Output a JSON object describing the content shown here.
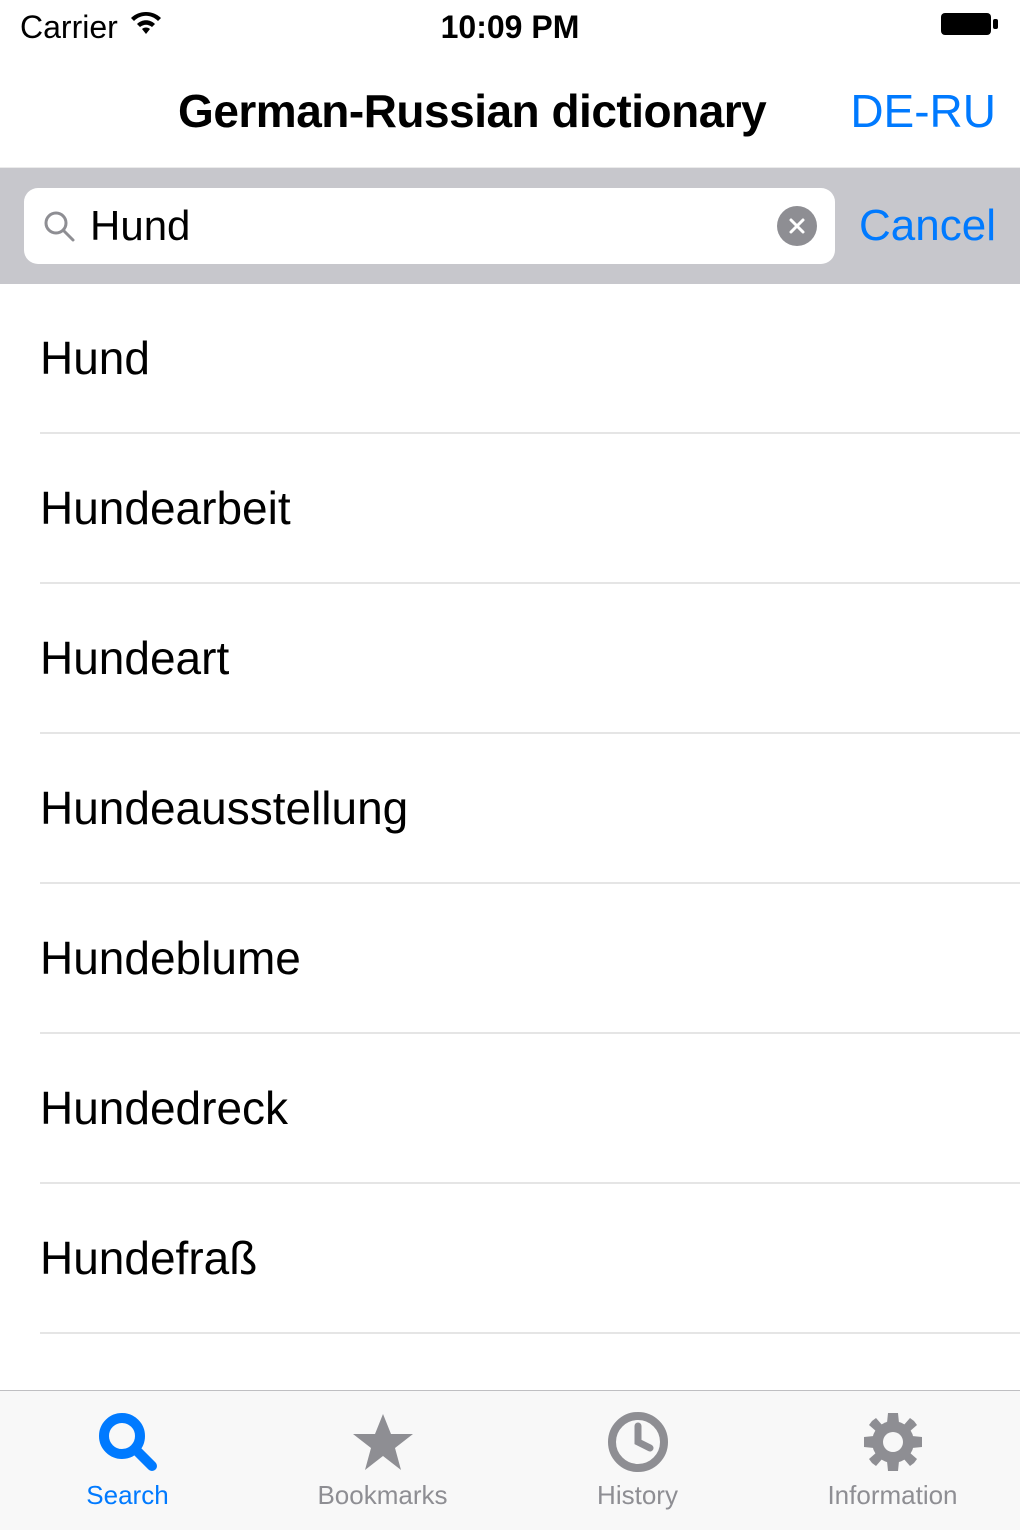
{
  "status": {
    "carrier": "Carrier",
    "time": "10:09 PM"
  },
  "nav": {
    "title": "German-Russian dictionary",
    "right_button": "DE-RU"
  },
  "search": {
    "value": "Hund",
    "cancel": "Cancel"
  },
  "results": [
    "Hund",
    "Hundearbeit",
    "Hundeart",
    "Hundeausstellung",
    "Hundeblume",
    "Hundedreck",
    "Hundefraß"
  ],
  "tabs": [
    {
      "label": "Search",
      "icon": "search-icon",
      "active": true
    },
    {
      "label": "Bookmarks",
      "icon": "star-icon",
      "active": false
    },
    {
      "label": "History",
      "icon": "clock-icon",
      "active": false
    },
    {
      "label": "Information",
      "icon": "gear-icon",
      "active": false
    }
  ]
}
